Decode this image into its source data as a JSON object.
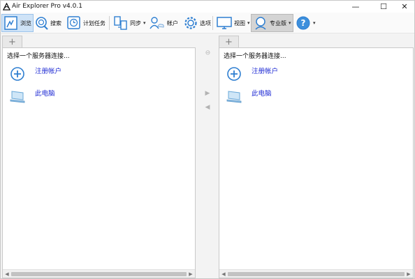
{
  "window": {
    "title": "Air Explorer Pro v4.0.1",
    "controls": {
      "minimize": "—",
      "maximize": "☐",
      "close": "✕"
    }
  },
  "toolbar": {
    "browse": "浏览",
    "search": "搜索",
    "scheduled_tasks": "计划任务",
    "sync": "同步",
    "accounts": "帐户",
    "options": "选项",
    "view": "视图",
    "pro": "专业版",
    "dropdown_arrow": "▾"
  },
  "left_pane": {
    "new_tab_glyph": "+",
    "hint": "选择一个服务器连接...",
    "items": [
      {
        "label": "注册帐户",
        "icon": "add-circle-icon"
      },
      {
        "label": "此电脑",
        "icon": "computer-icon"
      }
    ]
  },
  "right_pane": {
    "new_tab_glyph": "+",
    "hint": "选择一个服务器连接...",
    "items": [
      {
        "label": "注册帐户",
        "icon": "add-circle-icon"
      },
      {
        "label": "此电脑",
        "icon": "computer-icon"
      }
    ]
  },
  "middle": {
    "link_glyph": "⊘",
    "copy_right": "▶",
    "copy_left": "◀"
  },
  "scrollbar": {
    "left_arrow": "◀",
    "right_arrow": "▶"
  },
  "colors": {
    "accent": "#2f7fd1",
    "link": "#1f2bd4",
    "active_tab": "#cfe3f7"
  }
}
